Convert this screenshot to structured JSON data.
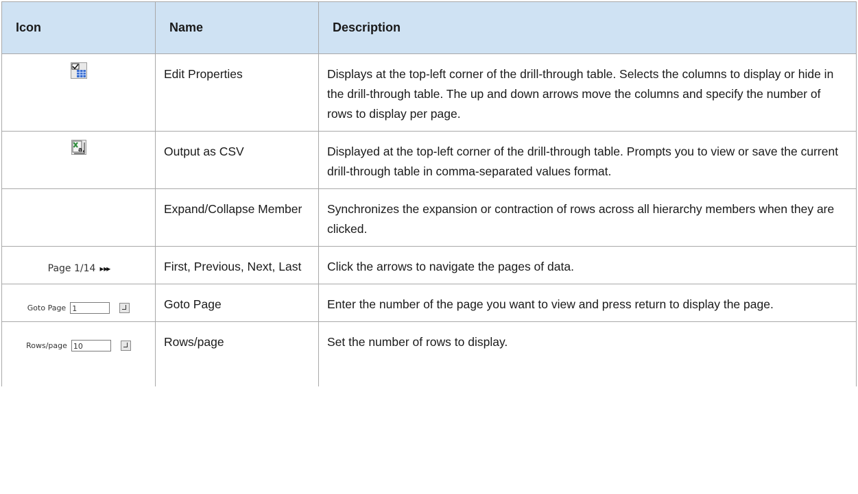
{
  "table": {
    "headers": {
      "icon": "Icon",
      "name": "Name",
      "description": "Description"
    },
    "rows": [
      {
        "icon": "edit-properties-icon",
        "name": "Edit Properties",
        "description": "Displays at the top-left corner of the drill-through table. Selects the columns to display or hide in the drill-through table. The up and down arrows move the columns and specify the number of rows to display per page."
      },
      {
        "icon": "output-csv-icon",
        "name": "Output as CSV",
        "description": "Displayed at the top-left corner of the drill-through table. Prompts you to view or save the current drill-through table in comma-separated values format."
      },
      {
        "icon": "",
        "name": "Expand/Collapse Member",
        "description": "Synchronizes the expansion or contraction of rows across all hierarchy members when they are clicked."
      },
      {
        "icon": "page-navigation-icon",
        "name": "First, Previous, Next, Last",
        "description": "Click the arrows to navigate the pages of data.",
        "widget": {
          "label": "Page 1/14",
          "arrows": "▸ ▸▸"
        }
      },
      {
        "icon": "goto-page-icon",
        "name": "Goto Page",
        "description": "Enter the number of the page you want to view and press return to display the page.",
        "widget": {
          "label": "Goto Page",
          "value": "1"
        }
      },
      {
        "icon": "rows-per-page-icon",
        "name": "Rows/page",
        "description": "Set the number of rows to display.",
        "widget": {
          "label": "Rows/page",
          "value": "10"
        }
      }
    ]
  },
  "colors": {
    "header_bg": "#cfe2f3",
    "border": "#a8a8a8",
    "csv_green": "#2e8b3a",
    "grid_blue": "#1f4fa8"
  }
}
